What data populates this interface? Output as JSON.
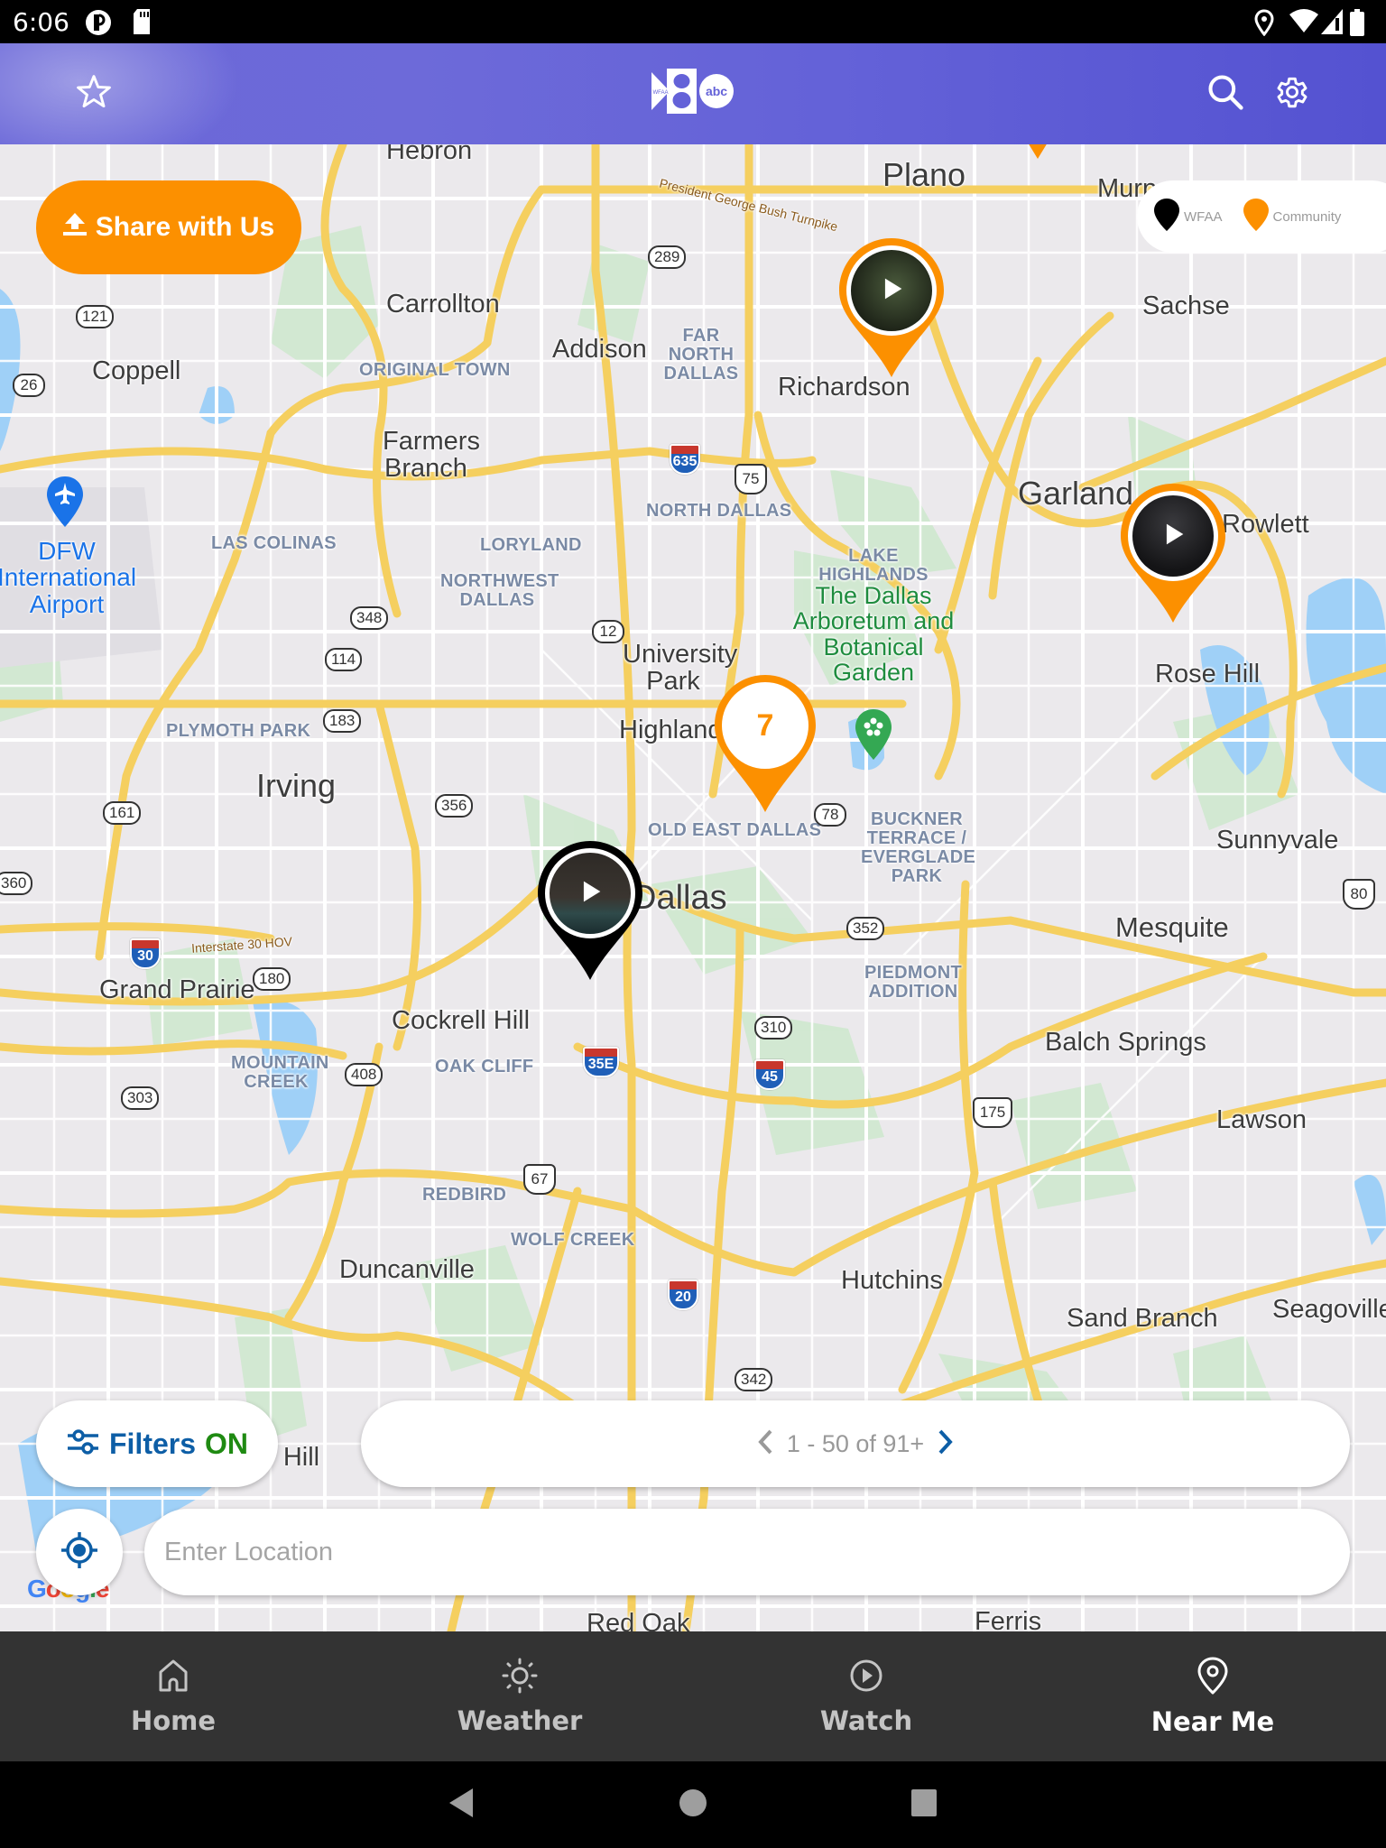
{
  "status_bar": {
    "time": "6:06"
  },
  "header": {
    "logo_text": "WFAA 8 abc",
    "logo_small": "WFAA",
    "logo_number": "8",
    "logo_network": "abc",
    "icons": {
      "left": "star-icon",
      "search": "search-icon",
      "settings": "gear-icon"
    }
  },
  "map": {
    "share_button": {
      "label": "Share with Us",
      "icon": "upload-icon"
    },
    "legend": [
      {
        "label": "WFAA",
        "color": "#000000"
      },
      {
        "label": "Community",
        "color": "#fc9000"
      }
    ],
    "markers": [
      {
        "type": "video",
        "source": "Community",
        "near": "Richardson",
        "icon": "play-icon"
      },
      {
        "type": "video",
        "source": "Community",
        "near": "Rowlett",
        "icon": "play-icon"
      },
      {
        "type": "cluster",
        "source": "Community",
        "count": "7",
        "near": "Highland Park"
      },
      {
        "type": "video",
        "source": "WFAA",
        "near": "Dallas",
        "icon": "play-icon"
      },
      {
        "type": "partial",
        "source": "Community",
        "near": "Murphy"
      }
    ],
    "labels": {
      "cities": [
        "Hebron",
        "Plano",
        "Murphy",
        "Carrollton",
        "Addison",
        "Richardson",
        "Sachse",
        "Coppell",
        "Farmers Branch",
        "Garland",
        "Rowlett",
        "University Park",
        "Highland Park",
        "Irving",
        "Rose Hill",
        "Sunnyvale",
        "Dallas",
        "Mesquite",
        "Grand Prairie",
        "Cockrell Hill",
        "Balch Springs",
        "Lawson",
        "Duncanville",
        "Hutchins",
        "Sand Branch",
        "Seagoville",
        "Cedar Hill",
        "Red Oak",
        "Ferris"
      ],
      "neighborhoods": [
        "FAR NORTH DALLAS",
        "ORIGINAL TOWN",
        "NORTH DALLAS",
        "LAS COLINAS",
        "LORYLAND",
        "NORTHWEST DALLAS",
        "LAKE HIGHLANDS",
        "PLYMOTH PARK",
        "OLD EAST DALLAS",
        "BUCKNER TERRACE / EVERGLADE PARK",
        "PIEDMONT ADDITION",
        "MOUNTAIN CREEK",
        "OAK CLIFF",
        "REDBIRD",
        "WOLF CREEK"
      ],
      "poi": "The Dallas Arboretum and Botanical Garden",
      "airport": "DFW International Airport",
      "roads": [
        "President George Bush Turnpike",
        "Interstate 30 HOV"
      ],
      "shields": [
        "289",
        "121",
        "26",
        "635",
        "75",
        "348",
        "12",
        "114",
        "183",
        "161",
        "356",
        "78",
        "360",
        "30",
        "180",
        "352",
        "310",
        "35E",
        "45",
        "303",
        "408",
        "175",
        "80",
        "67",
        "20",
        "342"
      ]
    },
    "attribution": "Google"
  },
  "controls": {
    "filters": {
      "label": "Filters",
      "state": "ON"
    },
    "pager": {
      "text": "1 - 50 of 91+",
      "prev_icon": "chevron-left-icon",
      "next_icon": "chevron-right-icon"
    },
    "locate_icon": "crosshair-icon",
    "location_input": {
      "placeholder": "Enter Location",
      "value": ""
    }
  },
  "bottom_nav": {
    "items": [
      {
        "label": "Home",
        "icon": "home-icon",
        "active": false
      },
      {
        "label": "Weather",
        "icon": "sun-icon",
        "active": false
      },
      {
        "label": "Watch",
        "icon": "play-circle-icon",
        "active": false
      },
      {
        "label": "Near Me",
        "icon": "location-pin-icon",
        "active": true
      }
    ]
  },
  "colors": {
    "header": "#6462d8",
    "community": "#fc9000",
    "wfaa": "#000000",
    "filters_blue": "#0d5ea6",
    "filters_on_green": "#1f8a12",
    "nav_bg": "#333333"
  }
}
